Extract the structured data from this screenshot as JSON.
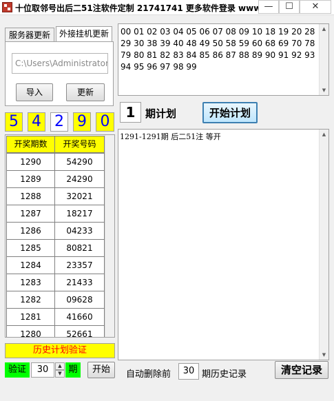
{
  "window": {
    "title": "十位取邻号出后二51注软件定制 21741741 更多软件登录 www.h...",
    "minimize": "—",
    "maximize": "☐",
    "close": "✕"
  },
  "tabs": [
    {
      "label": "服务器更新"
    },
    {
      "label": "外接挂机更新"
    }
  ],
  "update_panel": {
    "path_value": "C:\\Users\\Administrator\\",
    "import_label": "导入",
    "update_label": "更新"
  },
  "digits": [
    "5",
    "4",
    "2",
    "9",
    "0"
  ],
  "history_table": {
    "columns": [
      "开奖期数",
      "开奖号码"
    ],
    "rows": [
      [
        "1290",
        "54290"
      ],
      [
        "1289",
        "24290"
      ],
      [
        "1288",
        "32021"
      ],
      [
        "1287",
        "18217"
      ],
      [
        "1286",
        "04233"
      ],
      [
        "1285",
        "80821"
      ],
      [
        "1284",
        "23357"
      ],
      [
        "1283",
        "21433"
      ],
      [
        "1282",
        "09628"
      ],
      [
        "1281",
        "41660"
      ],
      [
        "1280",
        "52661"
      ]
    ]
  },
  "verification": {
    "history_button": "历史计划验证",
    "verify_label": "验证",
    "verify_value": "30",
    "period_unit": "期",
    "start_label": "开始"
  },
  "numbers_text": "00 01 02 03 04 05 06 07 08 09 10 18 19 20 28 29 30 38 39 40 48 49 50 58 59 60 68 69 70 78 79 80 81 82 83 84 85 86 87 88 89 90 91 92 93 94 95 96 97 98 99",
  "plan": {
    "period_value": "1",
    "period_label": "期计划",
    "start_plan_label": "开始计划"
  },
  "log": {
    "line1": "1291-1291期 后二51注 等开"
  },
  "footer": {
    "auto_delete_label": "自动删除前",
    "auto_delete_value": "30",
    "history_records_label": "期历史记录",
    "clear_label": "清空记录"
  },
  "colors": {
    "digit_bg": "#ffff00",
    "digit_fg": "#0000ff",
    "verify_bg": "#00ff00",
    "history_btn_fg": "#ff0000"
  }
}
